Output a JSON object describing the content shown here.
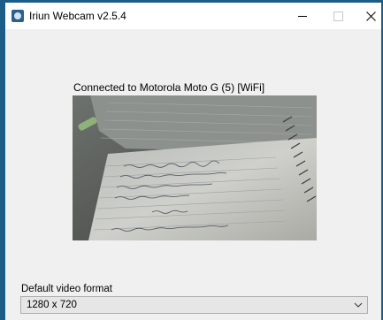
{
  "window": {
    "title": "Iriun Webcam v2.5.4"
  },
  "status": {
    "connected_text": "Connected to Motorola Moto G (5) [WiFi]"
  },
  "video_format": {
    "label": "Default video format",
    "selected": "1280 x 720"
  },
  "colors": {
    "desktop": "#1b5d86",
    "window_bg": "#f0f0f0",
    "titlebar_bg": "#ffffff"
  },
  "icons": {
    "app": "iriun-webcam-icon",
    "minimize": "minimize-icon",
    "maximize": "maximize-icon",
    "close": "close-icon",
    "dropdown": "chevron-down-icon"
  }
}
